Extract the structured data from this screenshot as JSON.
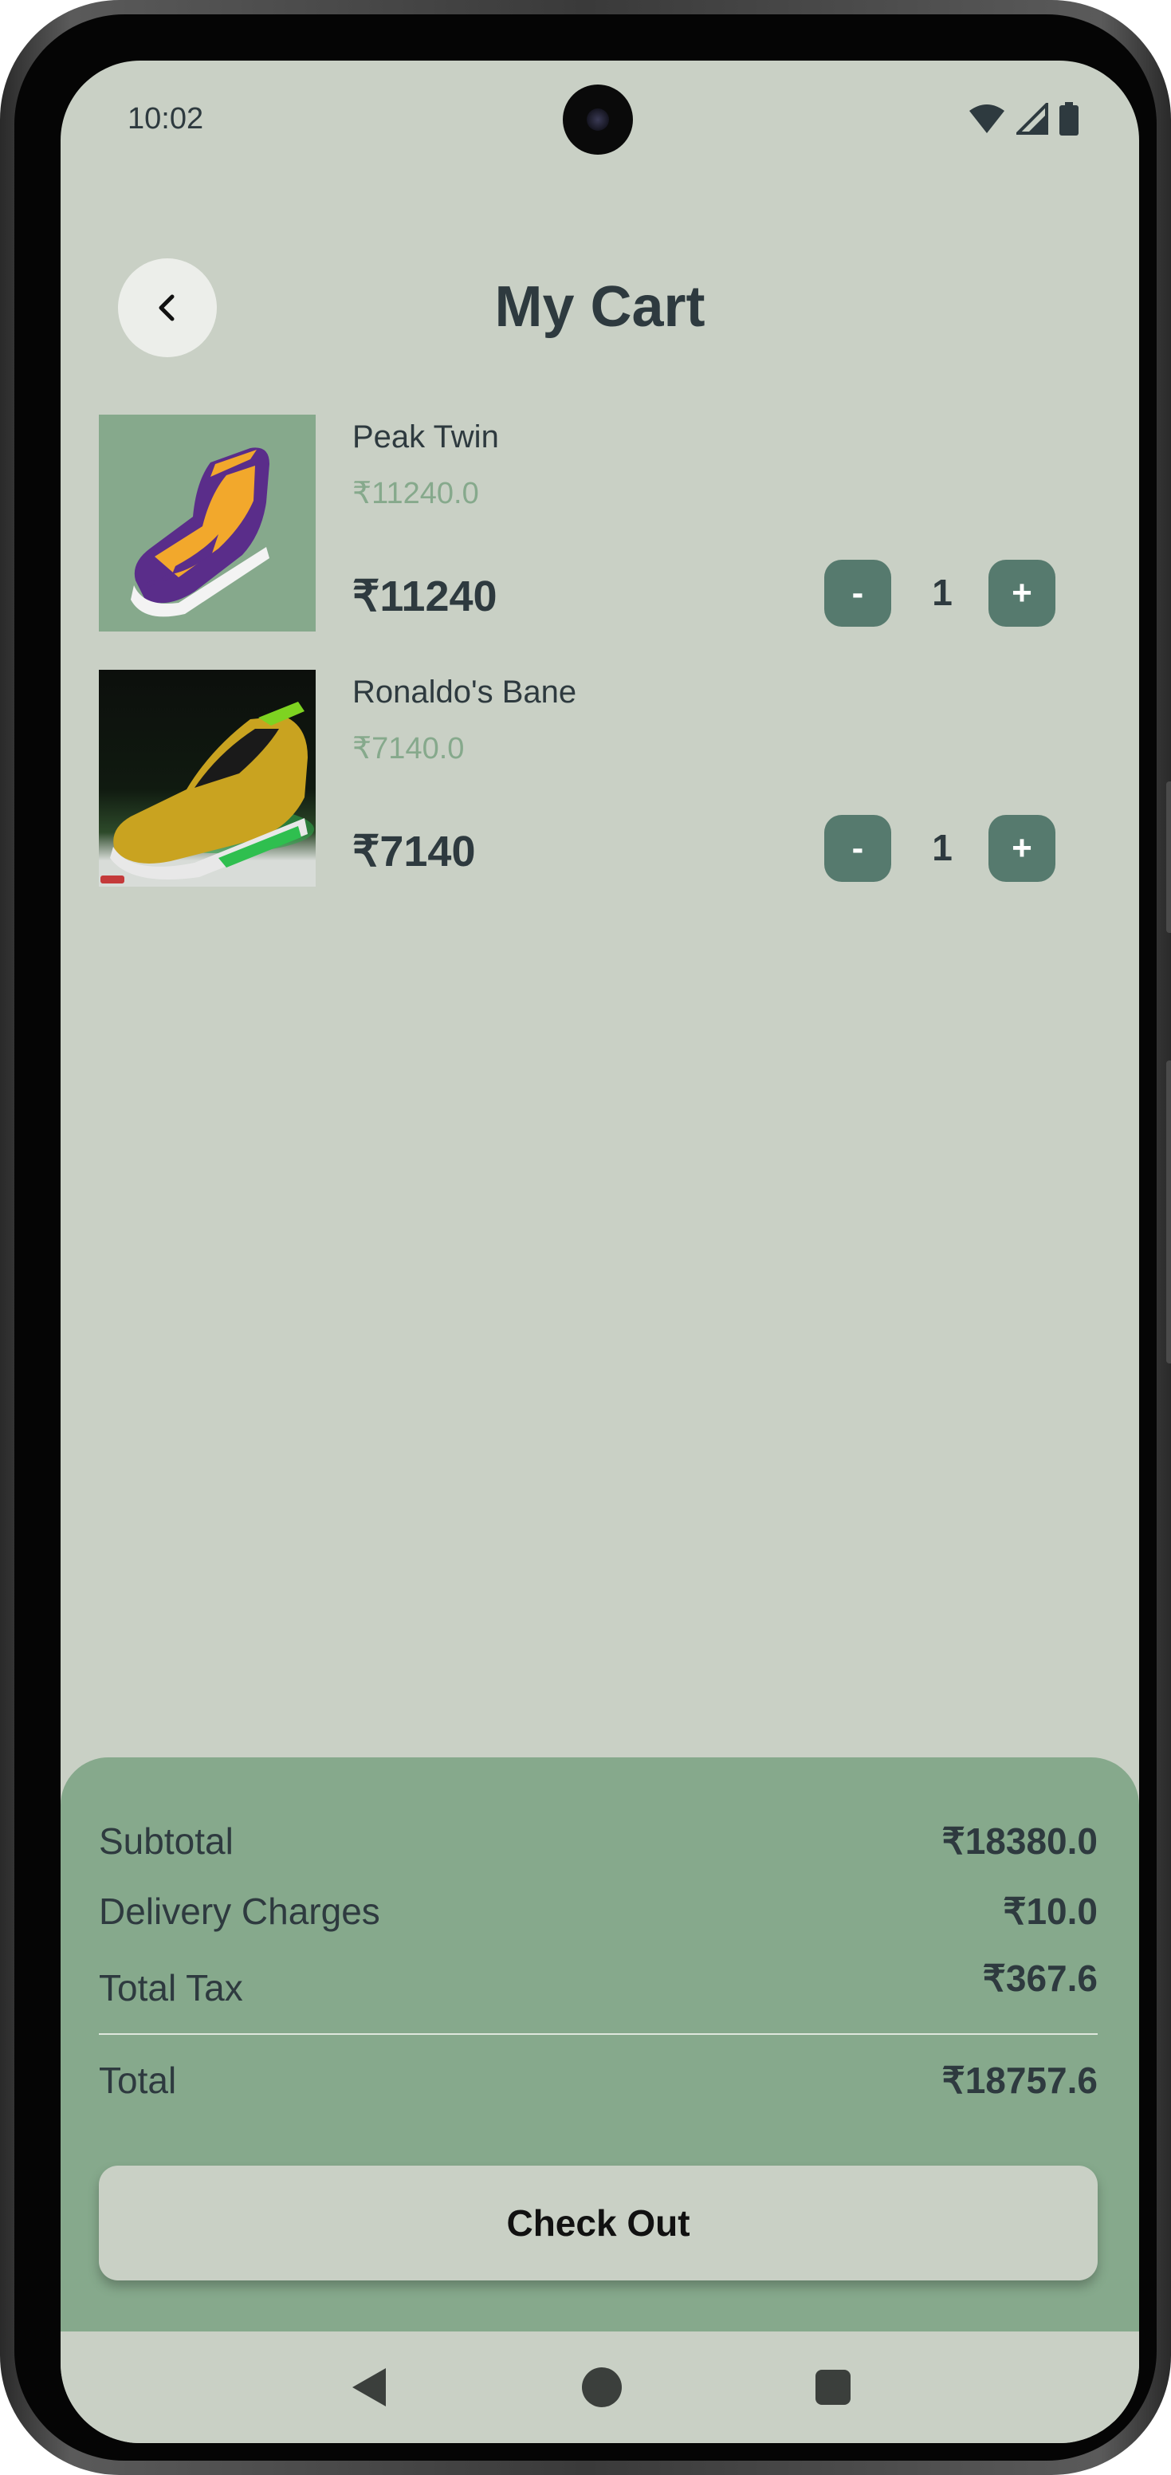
{
  "status_bar": {
    "time": "10:02",
    "icons": [
      "wifi-icon",
      "signal-icon",
      "battery-icon"
    ]
  },
  "header": {
    "back_icon": "chevron-left-icon",
    "title": "My Cart"
  },
  "cart": {
    "items": [
      {
        "name": "Peak Twin",
        "unit_price": "₹11240.0",
        "total_price": "₹11240",
        "quantity": "1",
        "minus_label": "-",
        "plus_label": "+"
      },
      {
        "name": "Ronaldo's Bane",
        "unit_price": "₹7140.0",
        "total_price": "₹7140",
        "quantity": "1",
        "minus_label": "-",
        "plus_label": "+"
      }
    ]
  },
  "summary": {
    "subtotal_label": "Subtotal",
    "subtotal_value": "₹18380.0",
    "delivery_label": "Delivery Charges",
    "delivery_value": "₹10.0",
    "tax_label": "Total Tax",
    "tax_value": "₹367.6",
    "total_label": "Total",
    "total_value": "₹18757.6",
    "checkout_label": "Check Out"
  },
  "nav_bar": {
    "icons": [
      "back-triangle-icon",
      "home-circle-icon",
      "recents-square-icon"
    ]
  },
  "colors": {
    "background": "#c9d0c5",
    "accent": "#567a6e",
    "summary_panel": "#86a98c",
    "text_dark": "#2e3a3f",
    "muted_price": "#86a98c"
  }
}
